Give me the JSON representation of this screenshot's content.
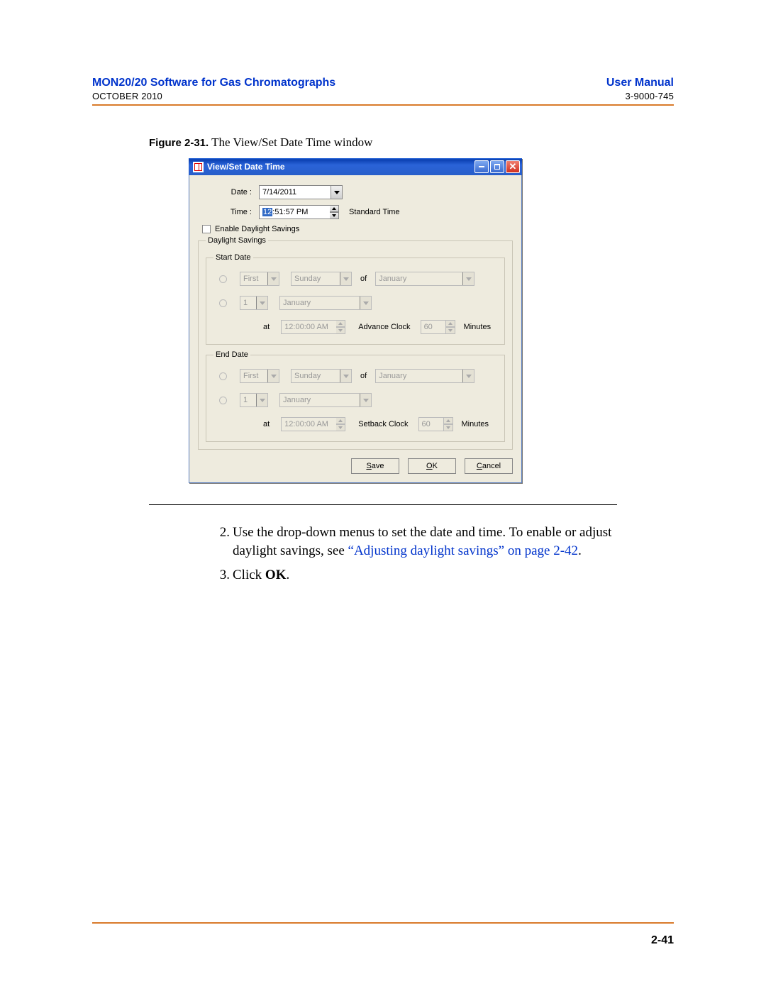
{
  "header": {
    "title_left": "MON20/20 Software for Gas Chromatographs",
    "title_right": "User Manual",
    "sub_left": "OCTOBER 2010",
    "sub_right": "3-9000-745"
  },
  "figure": {
    "label": "Figure 2-31.",
    "caption": "  The View/Set Date Time window"
  },
  "window": {
    "title": "View/Set Date Time",
    "date_label": "Date :",
    "date_value": "7/14/2011",
    "time_label": "Time :",
    "time_sel": "12",
    "time_rest": ":51:57 PM",
    "std_time": "Standard Time",
    "enable_ds": "Enable Daylight Savings",
    "ds_legend": "Daylight Savings",
    "start_legend": "Start Date",
    "end_legend": "End Date",
    "ord_first": "First",
    "day_sunday": "Sunday",
    "of": "of",
    "month_jan": "January",
    "num_one": "1",
    "at": "at",
    "time_noon": "12:00:00 AM",
    "advance": "Advance Clock",
    "setback": "Setback Clock",
    "sixty": "60",
    "minutes": "Minutes",
    "save": "Save",
    "ok": "OK",
    "cancel": "Cancel",
    "save_u": "S",
    "ok_u": "O",
    "cancel_u": "C",
    "save_rest": "ave",
    "ok_rest": "K",
    "cancel_rest": "ancel"
  },
  "steps": {
    "s2n": "2.",
    "s2a": "Use the drop-down menus to set the date and time.  To enable or adjust daylight savings, see ",
    "s2link": "“Adjusting daylight savings” on page 2-42",
    "s2b": ".",
    "s3n": "3.",
    "s3a": "Click ",
    "s3b": "OK",
    "s3c": "."
  },
  "page_number": "2-41"
}
